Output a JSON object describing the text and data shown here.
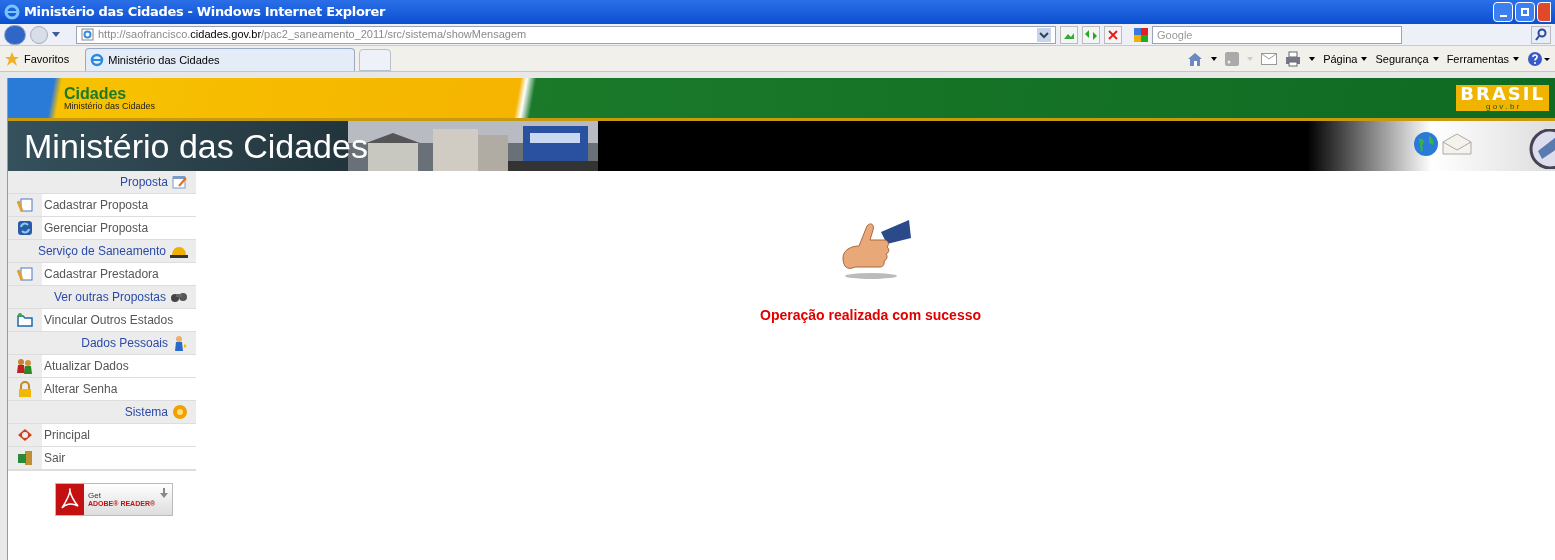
{
  "window": {
    "title": "Ministério das Cidades - Windows Internet Explorer"
  },
  "address": {
    "url": "http://saofrancisco.**cidades.gov.br**/pac2_saneamento_2011/src/sistema/showMensagem"
  },
  "search": {
    "placeholder": "Google"
  },
  "favorites": {
    "label": "Favoritos"
  },
  "tabs": [
    {
      "label": "Ministério das Cidades",
      "selected": true
    }
  ],
  "command_bar": [
    "Página",
    "Segurança",
    "Ferramentas"
  ],
  "header": {
    "brand": "Cidades",
    "brand_sub": "Ministério das Cidades",
    "gov_logo": "BRASIL",
    "gov_sub": "g o v . b r",
    "title": "Ministério das Cidades"
  },
  "sidebar": {
    "sections": [
      {
        "title": "Proposta",
        "items": [
          {
            "label": "Cadastrar Proposta"
          },
          {
            "label": "Gerenciar Proposta"
          }
        ]
      },
      {
        "title": "Serviço de Saneamento",
        "items": [
          {
            "label": "Cadastrar Prestadora"
          }
        ]
      },
      {
        "title": "Ver outras Propostas",
        "items": [
          {
            "label": "Vincular Outros Estados"
          }
        ]
      },
      {
        "title": "Dados Pessoais",
        "items": [
          {
            "label": "Atualizar Dados"
          },
          {
            "label": "Alterar Senha"
          }
        ]
      },
      {
        "title": "Sistema",
        "items": [
          {
            "label": "Principal"
          },
          {
            "label": "Sair"
          }
        ]
      }
    ]
  },
  "adobe_badge": {
    "get": "Get",
    "product": "ADOBE® READER®"
  },
  "message": {
    "text": "Operação realizada com sucesso"
  }
}
